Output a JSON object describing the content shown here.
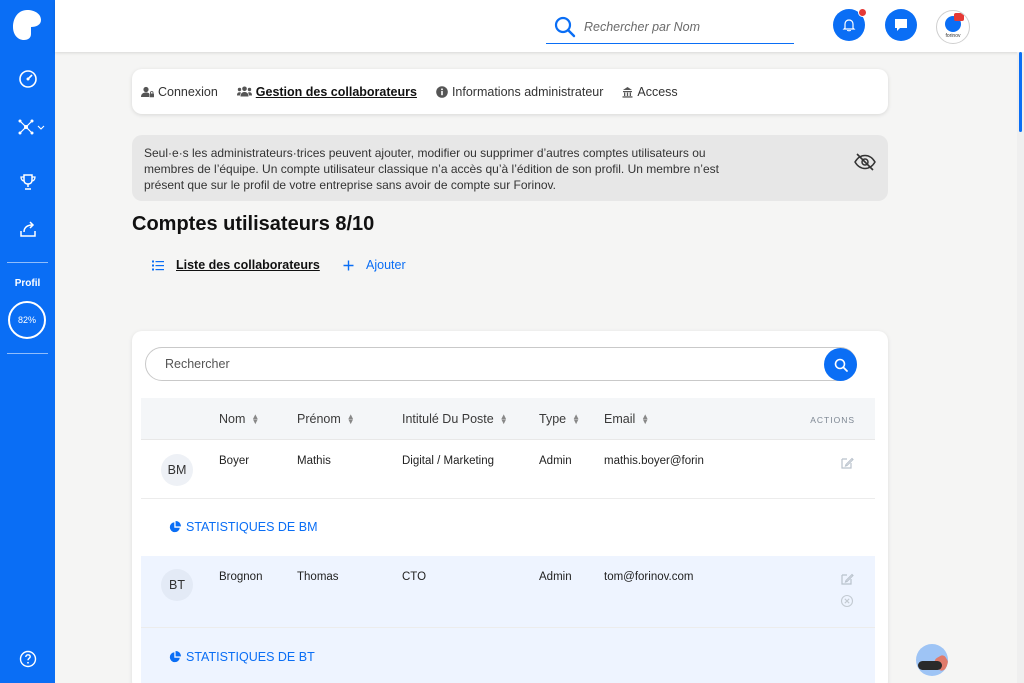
{
  "sidebar": {
    "profile_label": "Profil",
    "profile_percent": "82%"
  },
  "topbar": {
    "search_placeholder": "Rechercher par Nom"
  },
  "avatar": {
    "brand_text": "forinov"
  },
  "tabs": [
    {
      "label": "Connexion"
    },
    {
      "label": "Gestion des collaborateurs"
    },
    {
      "label": "Informations administrateur"
    },
    {
      "label": "Access"
    }
  ],
  "info": {
    "text": "Seul·e·s les administrateurs·trices peuvent ajouter, modifier ou supprimer d’autres comptes utilisateurs ou membres de l’équipe. Un compte utilisateur classique n’a accès qu’à l’édition de son profil. Un membre n’est présent que sur le profil de votre entreprise sans avoir de compte sur Forinov."
  },
  "page": {
    "title": "Comptes utilisateurs 8/10",
    "list_tab": "Liste des collaborateurs",
    "add_tab": "Ajouter"
  },
  "table": {
    "search_placeholder": "Rechercher",
    "columns": [
      "Nom",
      "Prénom",
      "Intitulé Du Poste",
      "Type",
      "Email"
    ],
    "actions_label": "ACTIONS",
    "rows": [
      {
        "initials": "BM",
        "nom": "Boyer",
        "prenom": "Mathis",
        "poste": "Digital / Marketing",
        "type": "Admin",
        "email": "mathis.boyer@forin",
        "stats": "STATISTIQUES DE BM"
      },
      {
        "initials": "BT",
        "nom": "Brognon",
        "prenom": "Thomas",
        "poste": "CTO",
        "type": "Admin",
        "email": "tom@forinov.com",
        "stats": "STATISTIQUES DE BT"
      }
    ]
  },
  "colors": {
    "brand": "#0a6ef5",
    "notification": "#e53935"
  }
}
